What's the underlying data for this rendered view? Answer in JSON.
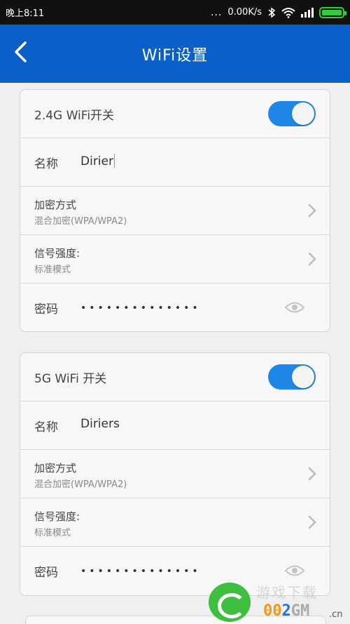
{
  "status_bar": {
    "time": "晚上8:11",
    "more": "...",
    "net_speed": "0.00K/s",
    "icons": [
      "bluetooth-icon",
      "wifi-icon",
      "signal-icon",
      "battery-icon"
    ]
  },
  "header": {
    "title": "WiFi设置",
    "back_icon": "chevron-left-icon",
    "color": "#0a5fc8"
  },
  "wifi_24": {
    "switch_label": "2.4G WiFi开关",
    "switch_on": true,
    "name_label": "名称",
    "name_value": "Dirier",
    "encryption_label": "加密方式",
    "encryption_value": "混合加密(WPA/WPA2)",
    "signal_label": "信号强度:",
    "signal_value": "标准模式",
    "password_label": "密码",
    "password_mask": "••••••••••••••"
  },
  "wifi_5g": {
    "switch_label": "5G WiFi 开关",
    "switch_on": true,
    "name_label": "名称",
    "name_value": "Diriers",
    "encryption_label": "加密方式",
    "encryption_value": "混合加密(WPA/WPA2)",
    "signal_label": "信号强度:",
    "signal_value": "标准模式",
    "password_label": "密码",
    "password_mask": "••••••••••••••"
  },
  "watermark": {
    "faint_text": "游戏下载",
    "digits": [
      "0",
      "0",
      "2",
      "GM"
    ],
    "suffix": ".cn"
  },
  "colors": {
    "accent": "#1e86e6",
    "status_bar": "#111111",
    "battery": "#2fcf3a"
  }
}
